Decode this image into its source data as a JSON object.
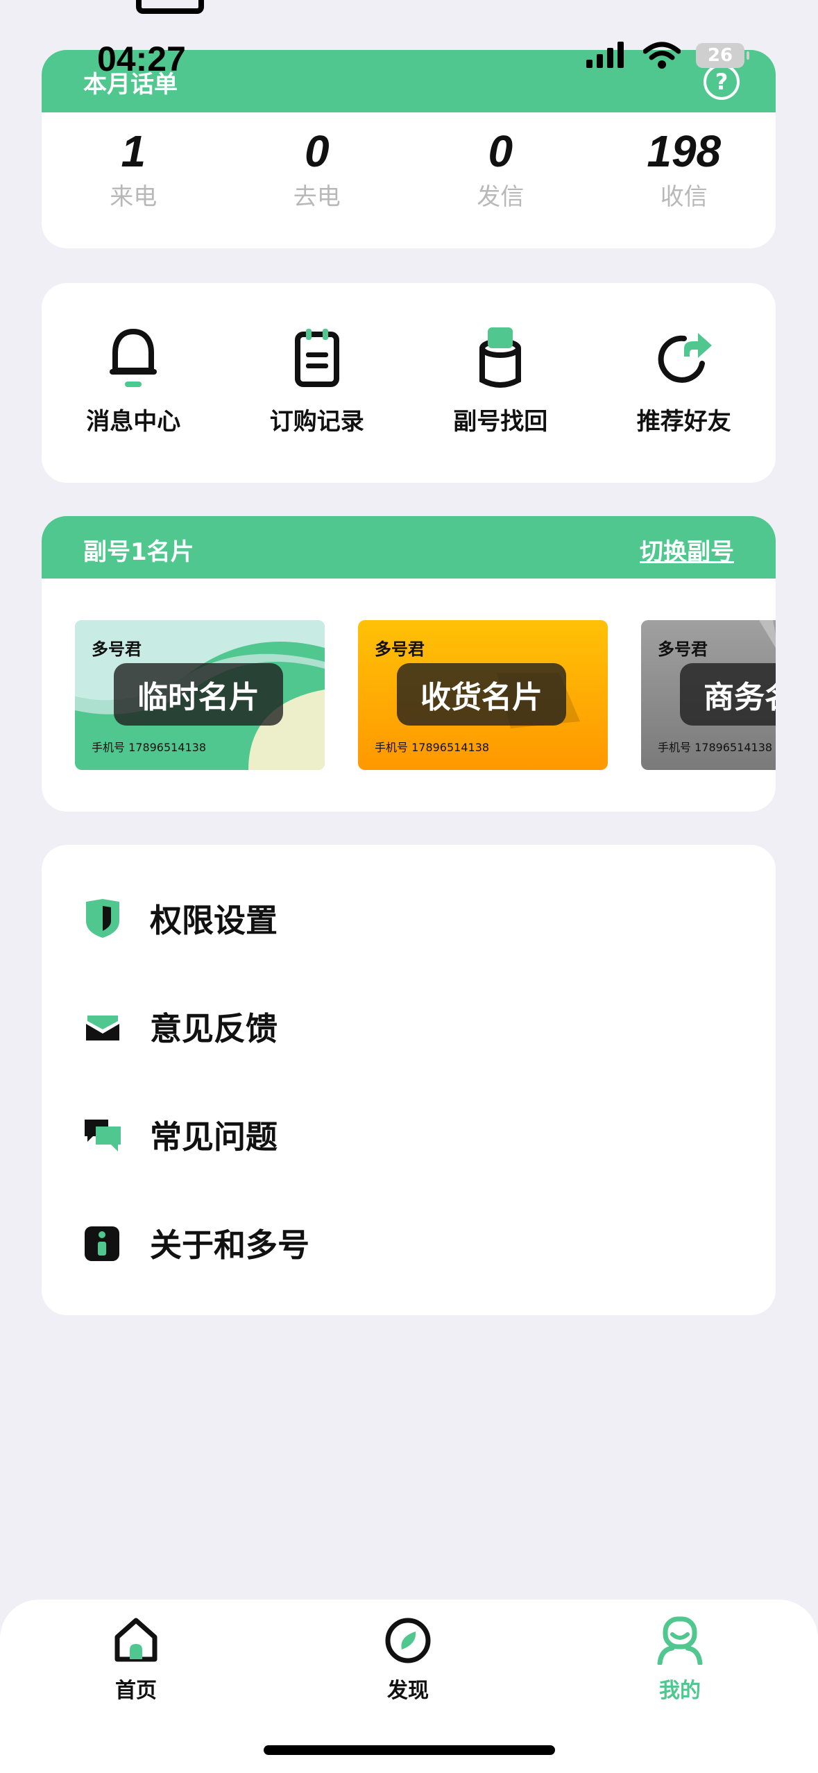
{
  "status_bar": {
    "time": "04:27",
    "battery": "26"
  },
  "bill": {
    "title": "本月话单",
    "help_icon": "?",
    "stats": [
      {
        "value": "1",
        "label": "来电"
      },
      {
        "value": "0",
        "label": "去电"
      },
      {
        "value": "0",
        "label": "发信"
      },
      {
        "value": "198",
        "label": "收信"
      }
    ]
  },
  "quick_actions": [
    {
      "label": "消息中心",
      "icon": "bell-icon"
    },
    {
      "label": "订购记录",
      "icon": "clipboard-icon"
    },
    {
      "label": "副号找回",
      "icon": "recover-icon"
    },
    {
      "label": "推荐好友",
      "icon": "share-icon"
    }
  ],
  "namecards": {
    "title": "副号1名片",
    "switch_label": "切换副号",
    "cards": [
      {
        "brand": "多号君",
        "name": "临时名片",
        "phone": "手机号  17896514138"
      },
      {
        "brand": "多号君",
        "name": "收货名片",
        "phone": "手机号  17896514138"
      },
      {
        "brand": "多号君",
        "name": "商务名片",
        "phone": "手机号  17896514138"
      }
    ]
  },
  "settings": [
    {
      "label": "权限设置",
      "icon": "shield-icon"
    },
    {
      "label": "意见反馈",
      "icon": "mail-icon"
    },
    {
      "label": "常见问题",
      "icon": "chat-icon"
    },
    {
      "label": "关于和多号",
      "icon": "info-icon"
    }
  ],
  "nav": [
    {
      "label": "首页",
      "icon": "home-icon"
    },
    {
      "label": "发现",
      "icon": "compass-icon"
    },
    {
      "label": "我的",
      "icon": "profile-icon"
    }
  ],
  "colors": {
    "accent": "#4fc78f",
    "background": "#efeff5"
  }
}
